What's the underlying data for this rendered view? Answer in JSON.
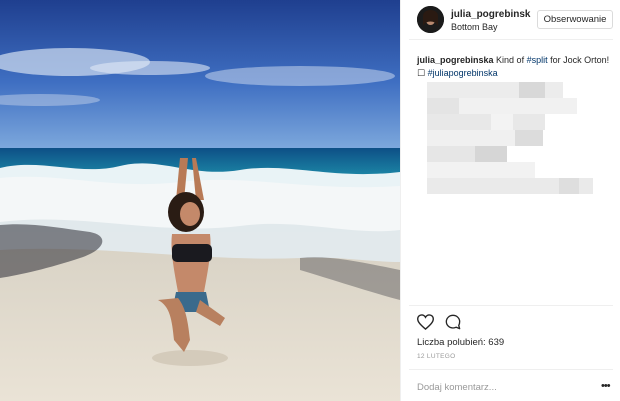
{
  "post": {
    "username": "julia_pogrebinsk",
    "location": "Bottom Bay",
    "follow_label": "Obserwowanie",
    "caption": {
      "user": "julia_pogrebinska",
      "text_1": "Kind of ",
      "tag_1": "#split",
      "text_2": " for Jock Orton!☐ ",
      "tag_2": "#juliapogrebinska"
    },
    "likes_label": "Liczba polubień: 639",
    "date": "12 LUTEGO",
    "comment_placeholder": "Dodaj komentarz...",
    "more_label": "•••"
  },
  "icons": {
    "like": "heart-icon",
    "comment": "comment-bubble-icon",
    "more": "more-options-icon"
  },
  "colors": {
    "hashtag": "#003569",
    "muted": "#999999",
    "border": "#dbdbdb"
  }
}
